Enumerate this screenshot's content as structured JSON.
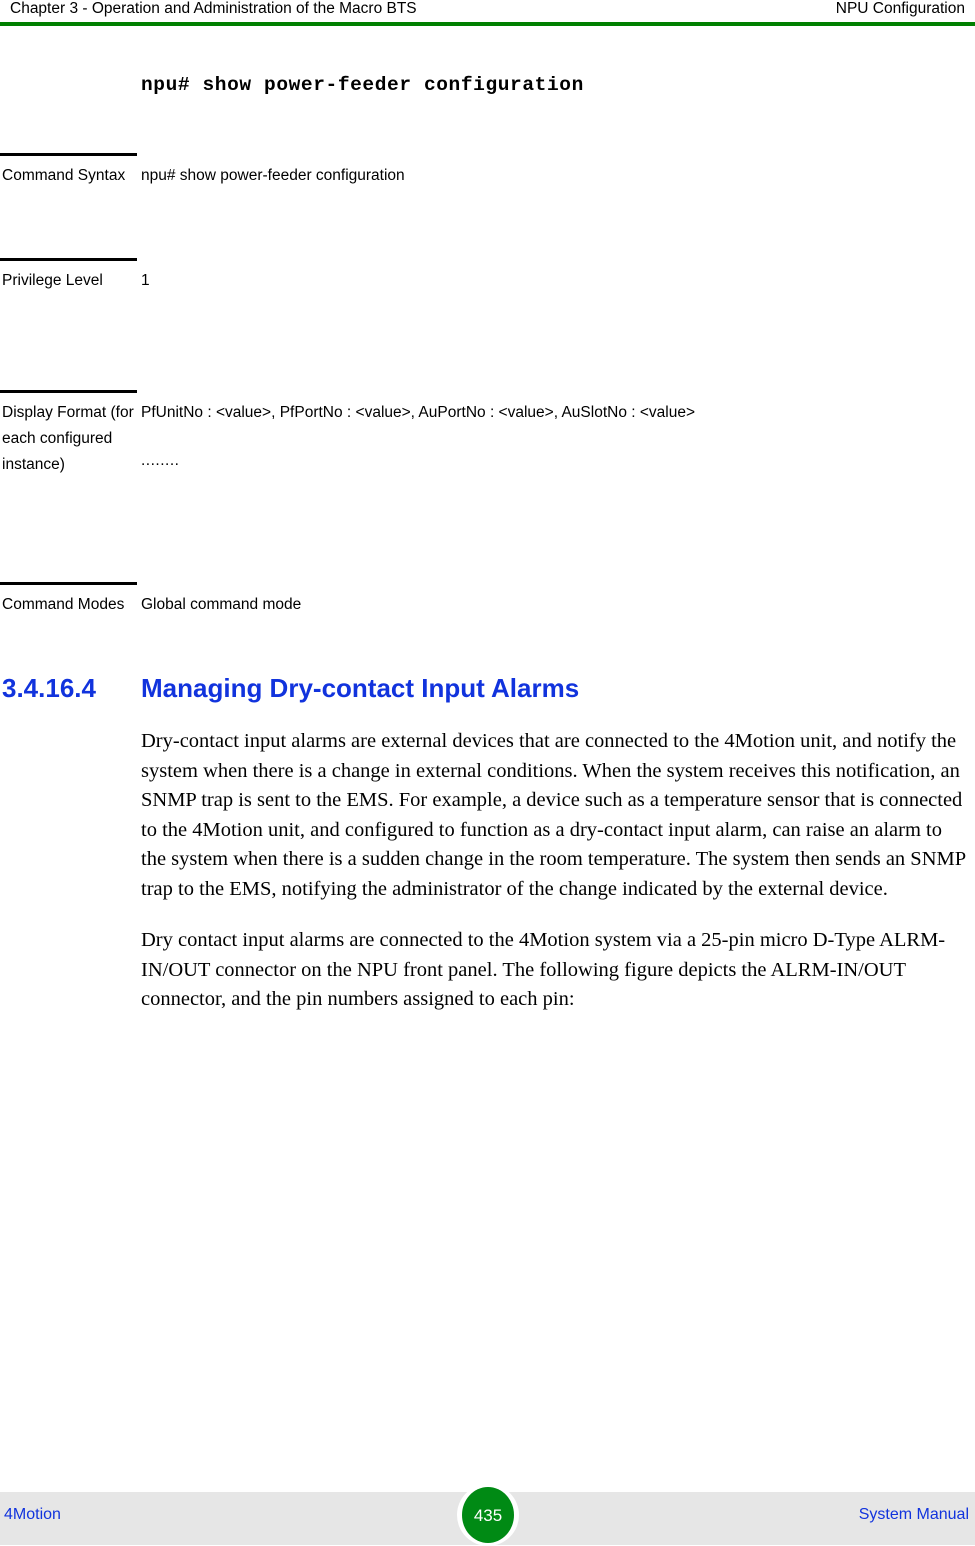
{
  "header": {
    "left": "Chapter 3 - Operation and Administration of the Macro BTS",
    "right": "NPU Configuration",
    "rule_color": "#008000"
  },
  "command_title": "npu# show power-feeder configuration",
  "definition_table": {
    "rows": [
      {
        "label": "Command Syntax",
        "value": "npu# show power-feeder configuration"
      },
      {
        "label": "Privilege Level",
        "value": "1"
      },
      {
        "label": "Display Format (for each configured instance)",
        "value": "PfUnitNo : <value>, PfPortNo : <value>, AuPortNo : <value>, AuSlotNo : <value>",
        "value_continued": "........"
      },
      {
        "label": "Command Modes",
        "value": "Global command mode"
      }
    ]
  },
  "section": {
    "number": "3.4.16.4",
    "title": "Managing Dry-contact Input Alarms",
    "color": "#1133dd"
  },
  "body": {
    "paragraphs": [
      "Dry-contact input alarms are external devices that are connected to the 4Motion unit, and notify the system when there is a change in external conditions. When the system receives this notification, an SNMP trap is sent to the EMS. For example, a device such as a temperature sensor that is connected to the 4Motion unit, and configured to function as a dry-contact input alarm, can raise an alarm to the system when there is a sudden change in the room temperature. The system then sends an SNMP trap to the EMS, notifying the administrator of the change indicated by the external device.",
      "Dry contact input alarms are connected to the 4Motion system via a 25-pin micro D-Type ALRM-IN/OUT connector on the NPU front panel. The following figure depicts the ALRM-IN/OUT connector, and the pin numbers assigned to each pin:"
    ]
  },
  "footer": {
    "left": "4Motion",
    "page_number": "435",
    "right": "System Manual",
    "band_color": "#e6e6e6",
    "badge_color": "#008a14",
    "link_color": "#1133dd"
  }
}
